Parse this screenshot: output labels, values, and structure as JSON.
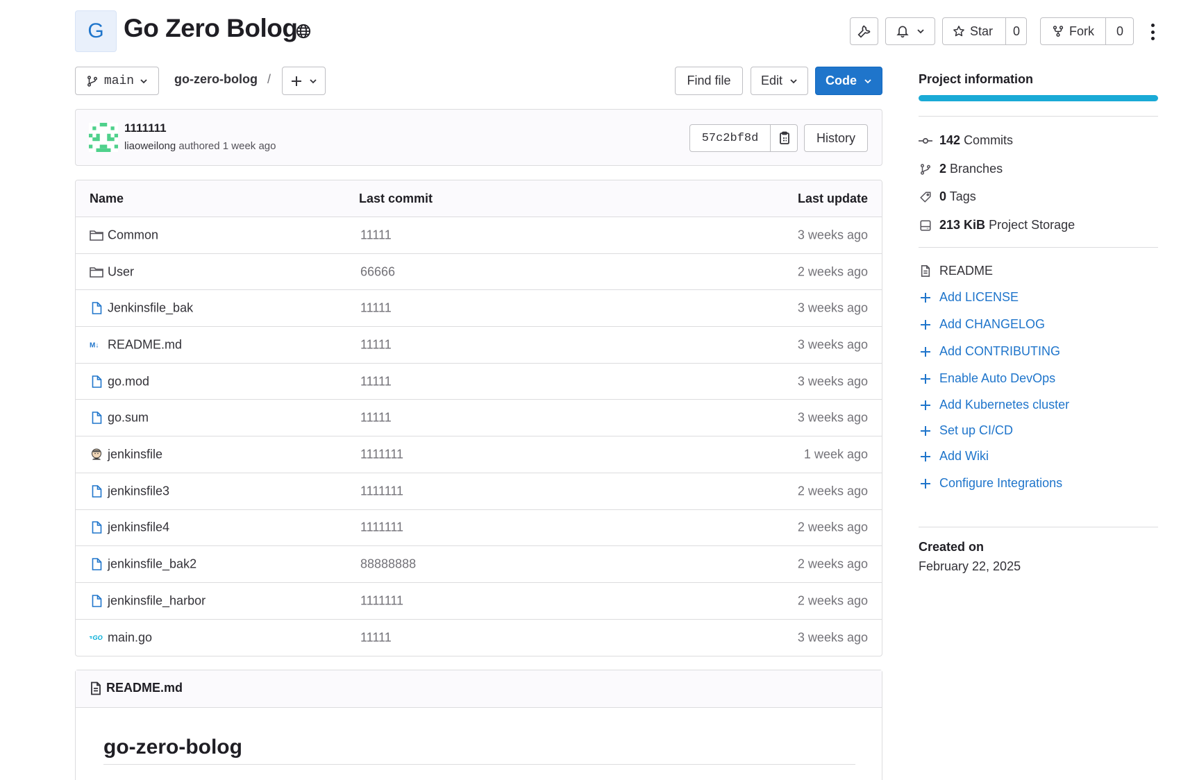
{
  "project": {
    "avatar_letter": "G",
    "title": "Go Zero Bolog"
  },
  "header_actions": {
    "star_label": "Star",
    "star_count": "0",
    "fork_label": "Fork",
    "fork_count": "0"
  },
  "toolbar": {
    "branch": "main",
    "breadcrumb": "go-zero-bolog",
    "slash": "/",
    "find_file": "Find file",
    "edit": "Edit",
    "code": "Code"
  },
  "last_commit": {
    "title": "1111111",
    "author": "liaoweilong",
    "authored_text": "authored 1 week ago",
    "sha": "57c2bf8d",
    "history": "History"
  },
  "table": {
    "headers": {
      "name": "Name",
      "last_commit": "Last commit",
      "last_update": "Last update"
    },
    "rows": [
      {
        "name": "Common",
        "icon": "folder-icon",
        "commit": "11111",
        "updated": "3 weeks ago"
      },
      {
        "name": "User",
        "icon": "folder-icon",
        "commit": "66666",
        "updated": "2 weeks ago"
      },
      {
        "name": "Jenkinsfile_bak",
        "icon": "file-icon",
        "commit": "11111",
        "updated": "3 weeks ago"
      },
      {
        "name": "README.md",
        "icon": "markdown-icon",
        "commit": "11111",
        "updated": "3 weeks ago"
      },
      {
        "name": "go.mod",
        "icon": "file-icon",
        "commit": "11111",
        "updated": "3 weeks ago"
      },
      {
        "name": "go.sum",
        "icon": "file-icon",
        "commit": "11111",
        "updated": "3 weeks ago"
      },
      {
        "name": "jenkinsfile",
        "icon": "jenkins-icon",
        "commit": "1111111",
        "updated": "1 week ago"
      },
      {
        "name": "jenkinsfile3",
        "icon": "file-icon",
        "commit": "1111111",
        "updated": "2 weeks ago"
      },
      {
        "name": "jenkinsfile4",
        "icon": "file-icon",
        "commit": "1111111",
        "updated": "2 weeks ago"
      },
      {
        "name": "jenkinsfile_bak2",
        "icon": "file-icon",
        "commit": "88888888",
        "updated": "2 weeks ago"
      },
      {
        "name": "jenkinsfile_harbor",
        "icon": "file-icon",
        "commit": "1111111",
        "updated": "2 weeks ago"
      },
      {
        "name": "main.go",
        "icon": "go-icon",
        "commit": "11111",
        "updated": "3 weeks ago"
      }
    ]
  },
  "readme": {
    "filename": "README.md",
    "heading": "go-zero-bolog"
  },
  "sidebar": {
    "title": "Project information",
    "stats": {
      "commits_num": "142",
      "commits_label": "Commits",
      "branches_num": "2",
      "branches_label": "Branches",
      "tags_num": "0",
      "tags_label": "Tags",
      "storage_num": "213 KiB",
      "storage_label": "Project Storage"
    },
    "readme_link": "README",
    "links": [
      "Add LICENSE",
      "Add CHANGELOG",
      "Add CONTRIBUTING",
      "Enable Auto DevOps",
      "Add Kubernetes cluster",
      "Set up CI/CD",
      "Add Wiki",
      "Configure Integrations"
    ],
    "created_label": "Created on",
    "created_value": "February 22, 2025"
  },
  "colors": {
    "primary": "#1f75cb",
    "progress": "#1aaad6",
    "border": "#dcdcde"
  }
}
